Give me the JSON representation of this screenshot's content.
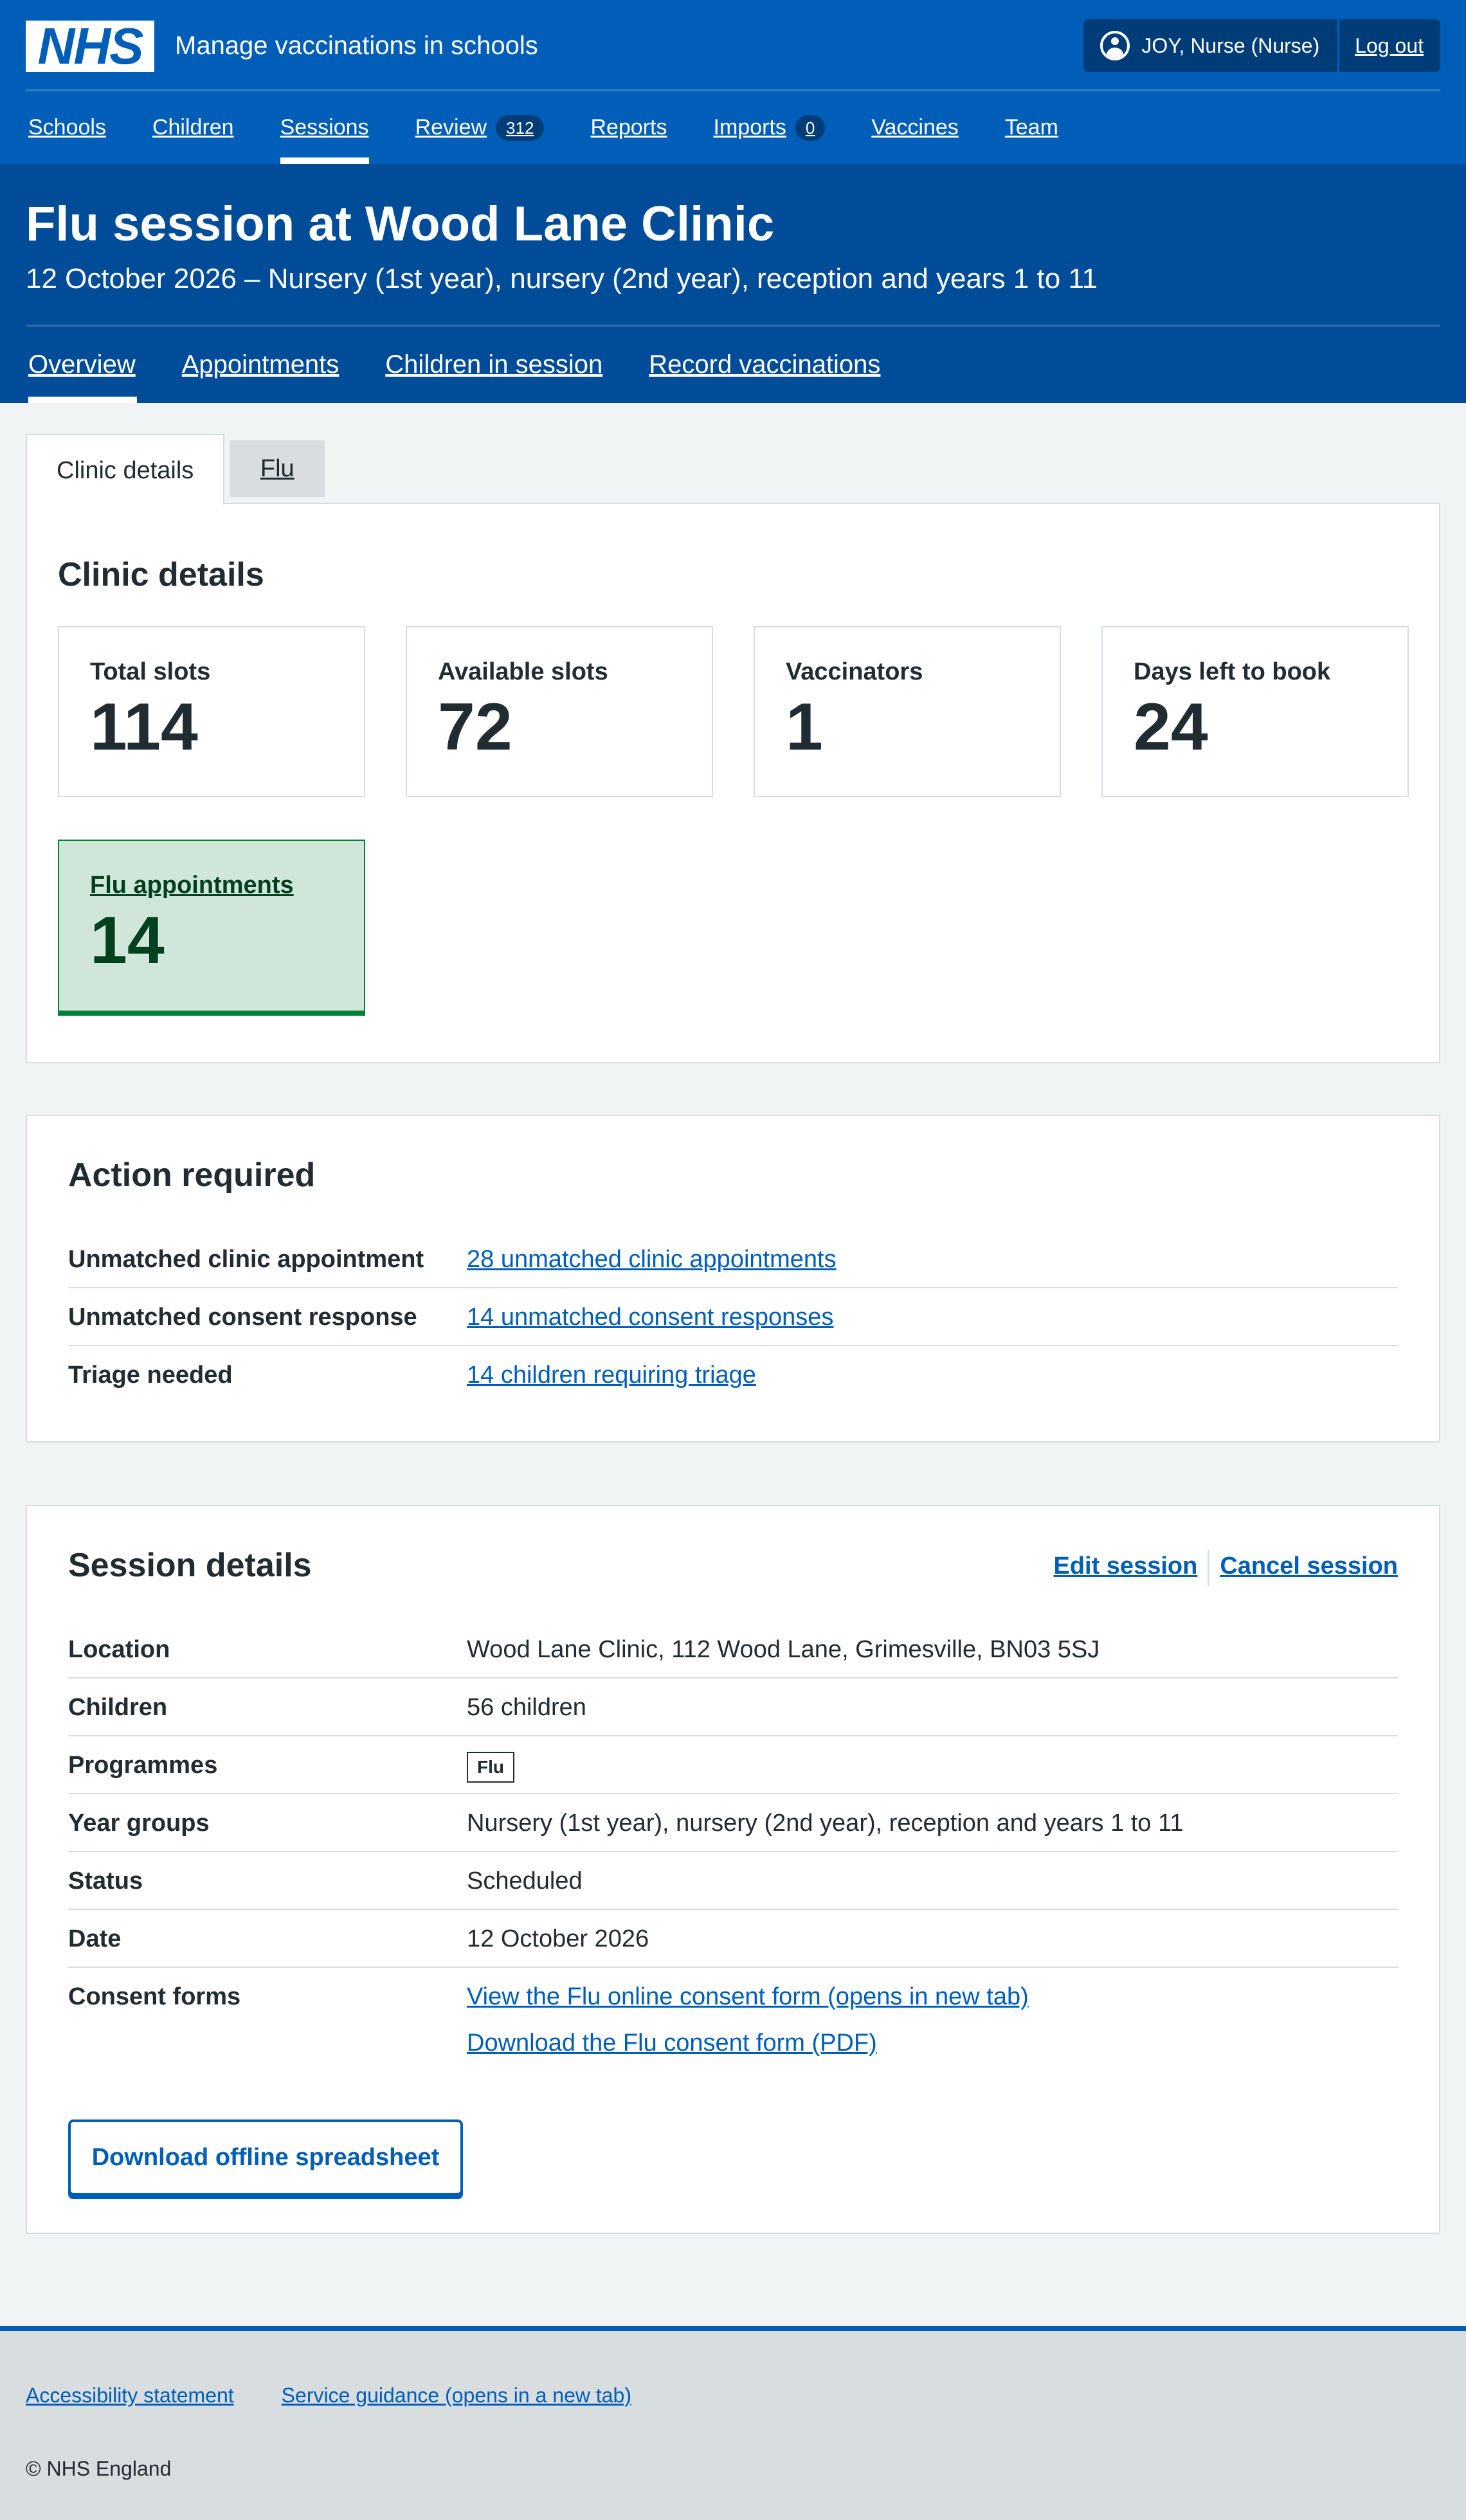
{
  "header": {
    "logo_text": "NHS",
    "service_name": "Manage vaccinations in schools",
    "user": "JOY, Nurse (Nurse)",
    "logout_label": "Log out"
  },
  "main_nav": [
    {
      "label": "Schools"
    },
    {
      "label": "Children"
    },
    {
      "label": "Sessions",
      "active": true
    },
    {
      "label": "Review",
      "badge": "312"
    },
    {
      "label": "Reports"
    },
    {
      "label": "Imports",
      "badge": "0"
    },
    {
      "label": "Vaccines"
    },
    {
      "label": "Team"
    }
  ],
  "page": {
    "title": "Flu session at Wood Lane Clinic",
    "subtitle": "12 October 2026 – Nursery (1st year), nursery (2nd year), reception and years 1 to 11"
  },
  "sub_nav": [
    {
      "label": "Overview",
      "active": true
    },
    {
      "label": "Appointments"
    },
    {
      "label": "Children in session"
    },
    {
      "label": "Record vaccinations"
    }
  ],
  "tabs": [
    {
      "label": "Clinic details",
      "selected": true
    },
    {
      "label": "Flu"
    }
  ],
  "clinic_details": {
    "heading": "Clinic details",
    "stats": [
      {
        "label": "Total slots",
        "value": "114"
      },
      {
        "label": "Available slots",
        "value": "72"
      },
      {
        "label": "Vaccinators",
        "value": "1"
      },
      {
        "label": "Days left to book",
        "value": "24"
      },
      {
        "label": "Flu appointments",
        "value": "14"
      }
    ]
  },
  "action_required": {
    "heading": "Action required",
    "rows": [
      {
        "key": "Unmatched clinic appointment",
        "link": "28 unmatched clinic appointments"
      },
      {
        "key": "Unmatched consent response",
        "link": "14 unmatched consent responses"
      },
      {
        "key": "Triage needed",
        "link": "14 children requiring triage"
      }
    ]
  },
  "session_details": {
    "heading": "Session details",
    "edit_label": "Edit session",
    "cancel_label": "Cancel session",
    "rows": {
      "location": {
        "key": "Location",
        "value": "Wood Lane Clinic, 112 Wood Lane, Grimesville, BN03 5SJ"
      },
      "children": {
        "key": "Children",
        "value": "56 children"
      },
      "programmes": {
        "key": "Programmes",
        "value": "Flu"
      },
      "year_groups": {
        "key": "Year groups",
        "value": "Nursery (1st year), nursery (2nd year), reception and years 1 to 11"
      },
      "status": {
        "key": "Status",
        "value": "Scheduled"
      },
      "date": {
        "key": "Date",
        "value": "12 October 2026"
      },
      "consent_forms": {
        "key": "Consent forms",
        "link_online": "View the Flu online consent form (opens in new tab)",
        "link_pdf": "Download the Flu consent form (PDF)"
      }
    },
    "download_button": "Download offline spreadsheet"
  },
  "footer": {
    "links": [
      "Accessibility statement",
      "Service guidance (opens in a new tab)"
    ],
    "copyright": "© NHS England"
  },
  "colors": {
    "nhs_blue": "#005eb8",
    "dark_blue": "#003d78",
    "band_blue": "#004c98",
    "green": "#007f3b",
    "green_bg": "#cfe6d9",
    "page_bg": "#f0f4f5",
    "border_grey": "#d8dde0"
  }
}
